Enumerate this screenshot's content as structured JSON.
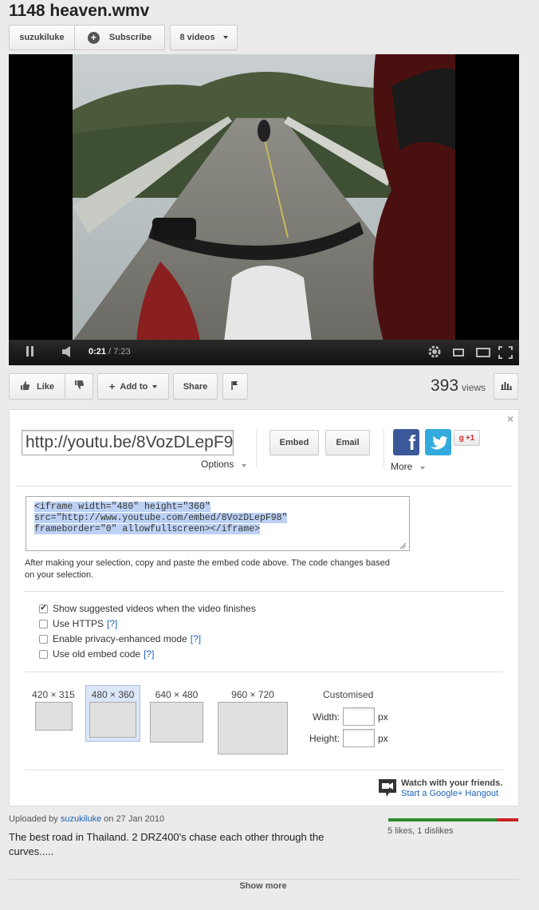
{
  "video": {
    "title": "1148 heaven.wmv",
    "channel": "suzukiluke",
    "subscribe_label": "Subscribe",
    "videos_label": "8 videos",
    "current_time": "0:21",
    "duration": "/ 7:23",
    "progress_fraction": 0.048
  },
  "actions": {
    "like_label": "Like",
    "add_to_label": "Add to",
    "share_label": "Share",
    "views_count": "393",
    "views_label": "views"
  },
  "share": {
    "url": "http://youtu.be/8VozDLepF98",
    "options_label": "Options",
    "embed_label": "Embed",
    "email_label": "Email",
    "more_label": "More",
    "gplus_label": "+1",
    "embed_code_line1": "<iframe width=\"480\" height=\"360\"",
    "embed_code_line2": "src=\"http://www.youtube.com/embed/8VozDLepF98\"",
    "embed_code_line3": "frameborder=\"0\" allowfullscreen></iframe>",
    "embed_help_line1": "After making your selection, copy and paste the embed code above. The code changes based",
    "embed_help_line2": "on your selection.",
    "options": [
      {
        "label": "Show suggested videos when the video finishes",
        "help": "",
        "checked": true
      },
      {
        "label": "Use HTTPS",
        "help": "[?]",
        "checked": false
      },
      {
        "label": "Enable privacy-enhanced mode",
        "help": "[?]",
        "checked": false
      },
      {
        "label": "Use old embed code",
        "help": "[?]",
        "checked": false
      }
    ],
    "sizes": [
      "420 × 315",
      "480 × 360",
      "640 × 480",
      "960 × 720"
    ],
    "customised_label": "Customised",
    "width_label": "Width:",
    "height_label": "Height:",
    "px_label": "px",
    "hangout_title": "Watch with your friends.",
    "hangout_link": "Start a Google+ Hangout"
  },
  "description": {
    "uploaded_by": "Uploaded by",
    "uploader": "suzukiluke",
    "date_text": "on 27 Jan 2010",
    "text_line1": "The best road in Thailand. 2 DRZ400's chase each other through the",
    "text_line2": "curves.....",
    "likes_text": "5 likes, 1 dislikes",
    "likes_fraction": 0.833,
    "show_more_label": "Show more"
  },
  "colors": {
    "like_bar": "#2e8b2e",
    "dislike_bar": "#cc1f1f",
    "link": "#1c62b9",
    "progress_played": "#cc0000",
    "facebook": "#3b5998",
    "twitter": "#33aadd"
  }
}
